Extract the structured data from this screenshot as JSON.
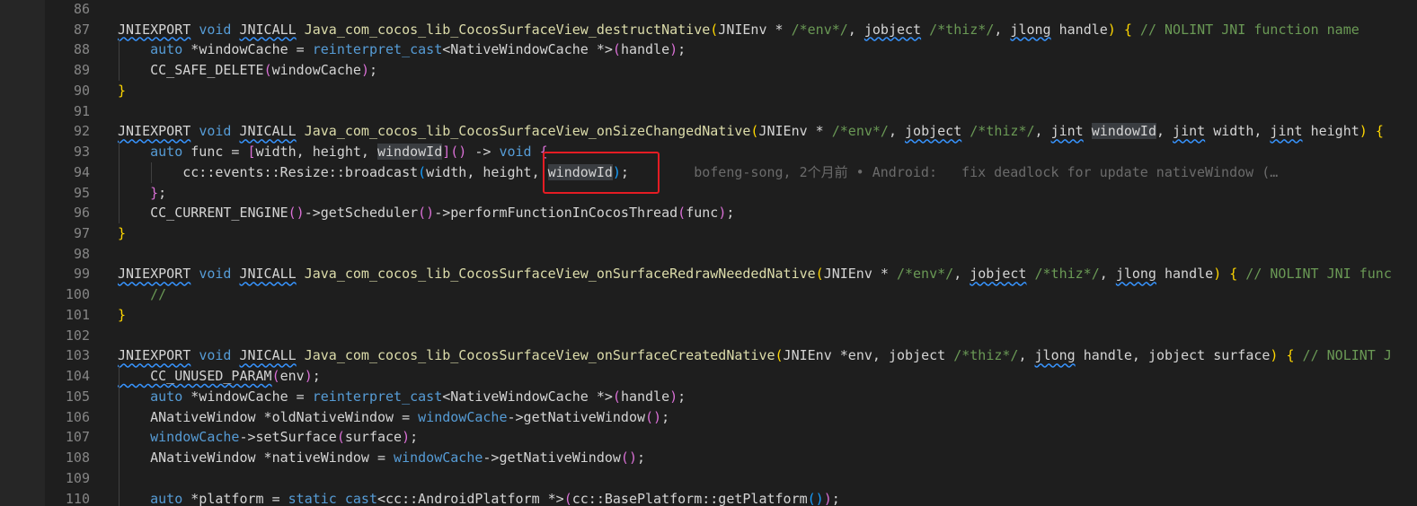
{
  "editor": {
    "lines": [
      {
        "n": "86",
        "segs": []
      },
      {
        "n": "87",
        "segs": [
          {
            "t": "JNIEXPORT",
            "c": "pl sq"
          },
          {
            "t": " ",
            "c": "pl"
          },
          {
            "t": "void",
            "c": "kw"
          },
          {
            "t": " ",
            "c": "pl"
          },
          {
            "t": "JNICALL",
            "c": "pl sq"
          },
          {
            "t": " Java_com_cocos_lib_CocosSurfaceView_destructNative",
            "c": "fn"
          },
          {
            "t": "(",
            "c": "br1"
          },
          {
            "t": "JNIEnv * ",
            "c": "pl"
          },
          {
            "t": "/*env*/",
            "c": "cm"
          },
          {
            "t": ", ",
            "c": "pl"
          },
          {
            "t": "jobject",
            "c": "pl sq"
          },
          {
            "t": " ",
            "c": "pl"
          },
          {
            "t": "/*thiz*/",
            "c": "cm"
          },
          {
            "t": ", ",
            "c": "pl"
          },
          {
            "t": "jlong",
            "c": "pl sq"
          },
          {
            "t": " handle",
            "c": "pl"
          },
          {
            "t": ")",
            "c": "br1"
          },
          {
            "t": " ",
            "c": "pl"
          },
          {
            "t": "{",
            "c": "br1"
          },
          {
            "t": " // NOLINT JNI function name",
            "c": "cm"
          }
        ]
      },
      {
        "n": "88",
        "segs": [
          {
            "t": "    ",
            "c": "pl"
          },
          {
            "t": "auto",
            "c": "kw"
          },
          {
            "t": " *",
            "c": "pl"
          },
          {
            "t": "windowCache",
            "c": "pl"
          },
          {
            "t": " = ",
            "c": "pl"
          },
          {
            "t": "reinterpret_cast",
            "c": "kw"
          },
          {
            "t": "<",
            "c": "pl"
          },
          {
            "t": "NativeWindowCache *",
            "c": "pl"
          },
          {
            "t": ">",
            "c": "pl"
          },
          {
            "t": "(",
            "c": "br2"
          },
          {
            "t": "handle",
            "c": "pl"
          },
          {
            "t": ")",
            "c": "br2"
          },
          {
            "t": ";",
            "c": "pl"
          }
        ]
      },
      {
        "n": "89",
        "segs": [
          {
            "t": "    CC_SAFE_DELETE",
            "c": "pl"
          },
          {
            "t": "(",
            "c": "br2"
          },
          {
            "t": "windowCache",
            "c": "pl"
          },
          {
            "t": ")",
            "c": "br2"
          },
          {
            "t": ";",
            "c": "pl"
          }
        ]
      },
      {
        "n": "90",
        "segs": [
          {
            "t": "}",
            "c": "br1"
          }
        ]
      },
      {
        "n": "91",
        "segs": []
      },
      {
        "n": "92",
        "segs": [
          {
            "t": "JNIEXPORT",
            "c": "pl sq"
          },
          {
            "t": " ",
            "c": "pl"
          },
          {
            "t": "void",
            "c": "kw"
          },
          {
            "t": " ",
            "c": "pl"
          },
          {
            "t": "JNICALL",
            "c": "pl sq"
          },
          {
            "t": " Java_com_cocos_lib_CocosSurfaceView_onSizeChangedNative",
            "c": "fn"
          },
          {
            "t": "(",
            "c": "br1"
          },
          {
            "t": "JNIEnv * ",
            "c": "pl"
          },
          {
            "t": "/*env*/",
            "c": "cm"
          },
          {
            "t": ", ",
            "c": "pl"
          },
          {
            "t": "jobject",
            "c": "pl sq"
          },
          {
            "t": " ",
            "c": "pl"
          },
          {
            "t": "/*thiz*/",
            "c": "cm"
          },
          {
            "t": ", ",
            "c": "pl"
          },
          {
            "t": "jint",
            "c": "pl sq"
          },
          {
            "t": " ",
            "c": "pl"
          },
          {
            "t": "windowId",
            "c": "pl sel"
          },
          {
            "t": ", ",
            "c": "pl"
          },
          {
            "t": "jint",
            "c": "pl sq"
          },
          {
            "t": " width, ",
            "c": "pl"
          },
          {
            "t": "jint",
            "c": "pl sq"
          },
          {
            "t": " height",
            "c": "pl"
          },
          {
            "t": ")",
            "c": "br1"
          },
          {
            "t": " ",
            "c": "pl"
          },
          {
            "t": "{",
            "c": "br1"
          }
        ]
      },
      {
        "n": "93",
        "segs": [
          {
            "t": "    ",
            "c": "pl"
          },
          {
            "t": "auto",
            "c": "kw"
          },
          {
            "t": " func = ",
            "c": "pl"
          },
          {
            "t": "[",
            "c": "br2"
          },
          {
            "t": "width, height, ",
            "c": "pl"
          },
          {
            "t": "windowId",
            "c": "pl sel"
          },
          {
            "t": "]",
            "c": "br2"
          },
          {
            "t": "()",
            "c": "br2"
          },
          {
            "t": " -> ",
            "c": "pl"
          },
          {
            "t": "void",
            "c": "kw"
          },
          {
            "t": " ",
            "c": "pl"
          },
          {
            "t": "{",
            "c": "br2"
          }
        ]
      },
      {
        "n": "94",
        "segs": [
          {
            "t": "        cc::events::Resize::broadcast",
            "c": "pl"
          },
          {
            "t": "(",
            "c": "br3"
          },
          {
            "t": "width, height, ",
            "c": "pl"
          },
          {
            "t": "windowId",
            "c": "pl sel"
          },
          {
            "t": ")",
            "c": "br3"
          },
          {
            "t": ";",
            "c": "pl"
          },
          {
            "t": "        bofeng-song, 2个月前 • Android:   fix deadlock for update nativeWindow (…",
            "c": "blame"
          }
        ]
      },
      {
        "n": "95",
        "segs": [
          {
            "t": "    ",
            "c": "pl"
          },
          {
            "t": "}",
            "c": "br2"
          },
          {
            "t": ";",
            "c": "pl"
          }
        ]
      },
      {
        "n": "96",
        "segs": [
          {
            "t": "    CC_CURRENT_ENGINE",
            "c": "pl"
          },
          {
            "t": "()",
            "c": "br2"
          },
          {
            "t": "->getScheduler",
            "c": "pl"
          },
          {
            "t": "()",
            "c": "br2"
          },
          {
            "t": "->performFunctionInCocosThread",
            "c": "pl"
          },
          {
            "t": "(",
            "c": "br2"
          },
          {
            "t": "func",
            "c": "pl"
          },
          {
            "t": ")",
            "c": "br2"
          },
          {
            "t": ";",
            "c": "pl"
          }
        ]
      },
      {
        "n": "97",
        "segs": [
          {
            "t": "}",
            "c": "br1"
          }
        ]
      },
      {
        "n": "98",
        "segs": []
      },
      {
        "n": "99",
        "segs": [
          {
            "t": "JNIEXPORT",
            "c": "pl sq"
          },
          {
            "t": " ",
            "c": "pl"
          },
          {
            "t": "void",
            "c": "kw"
          },
          {
            "t": " ",
            "c": "pl"
          },
          {
            "t": "JNICALL",
            "c": "pl sq"
          },
          {
            "t": " Java_com_cocos_lib_CocosSurfaceView_onSurfaceRedrawNeededNative",
            "c": "fn"
          },
          {
            "t": "(",
            "c": "br1"
          },
          {
            "t": "JNIEnv * ",
            "c": "pl"
          },
          {
            "t": "/*env*/",
            "c": "cm"
          },
          {
            "t": ", ",
            "c": "pl"
          },
          {
            "t": "jobject",
            "c": "pl sq"
          },
          {
            "t": " ",
            "c": "pl"
          },
          {
            "t": "/*thiz*/",
            "c": "cm"
          },
          {
            "t": ", ",
            "c": "pl"
          },
          {
            "t": "jlong",
            "c": "pl sq"
          },
          {
            "t": " handle",
            "c": "pl"
          },
          {
            "t": ")",
            "c": "br1"
          },
          {
            "t": " ",
            "c": "pl"
          },
          {
            "t": "{",
            "c": "br1"
          },
          {
            "t": " // NOLINT JNI func",
            "c": "cm"
          }
        ]
      },
      {
        "n": "100",
        "segs": [
          {
            "t": "    //",
            "c": "cm"
          }
        ]
      },
      {
        "n": "101",
        "segs": [
          {
            "t": "}",
            "c": "br1"
          }
        ]
      },
      {
        "n": "102",
        "segs": []
      },
      {
        "n": "103",
        "segs": [
          {
            "t": "JNIEXPORT",
            "c": "pl sq"
          },
          {
            "t": " ",
            "c": "pl"
          },
          {
            "t": "void",
            "c": "kw"
          },
          {
            "t": " ",
            "c": "pl"
          },
          {
            "t": "JNICALL",
            "c": "pl sq"
          },
          {
            "t": " Java_com_cocos_lib_CocosSurfaceView_onSurfaceCreatedNative",
            "c": "fn"
          },
          {
            "t": "(",
            "c": "br1"
          },
          {
            "t": "JNIEnv *env, jobject ",
            "c": "pl"
          },
          {
            "t": "/*thiz*/",
            "c": "cm"
          },
          {
            "t": ", ",
            "c": "pl"
          },
          {
            "t": "jlong",
            "c": "pl sq"
          },
          {
            "t": " handle, jobject surface",
            "c": "pl"
          },
          {
            "t": ")",
            "c": "br1"
          },
          {
            "t": " ",
            "c": "pl"
          },
          {
            "t": "{",
            "c": "br1"
          },
          {
            "t": " // NOLINT J",
            "c": "cm"
          }
        ]
      },
      {
        "n": "104",
        "segs": [
          {
            "t": "    CC_UNUSED_PARAM",
            "c": "pl sq"
          },
          {
            "t": "(",
            "c": "br2"
          },
          {
            "t": "env",
            "c": "pl"
          },
          {
            "t": ")",
            "c": "br2"
          },
          {
            "t": ";",
            "c": "pl"
          }
        ]
      },
      {
        "n": "105",
        "segs": [
          {
            "t": "    ",
            "c": "pl"
          },
          {
            "t": "auto",
            "c": "kw"
          },
          {
            "t": " *windowCache = ",
            "c": "pl"
          },
          {
            "t": "reinterpret_cast",
            "c": "kw"
          },
          {
            "t": "<NativeWindowCache *>",
            "c": "pl"
          },
          {
            "t": "(",
            "c": "br2"
          },
          {
            "t": "handle",
            "c": "pl"
          },
          {
            "t": ")",
            "c": "br2"
          },
          {
            "t": ";",
            "c": "pl"
          }
        ]
      },
      {
        "n": "106",
        "segs": [
          {
            "t": "    ANativeWindow *oldNativeWindow = ",
            "c": "pl"
          },
          {
            "t": "windowCache",
            "c": "kw"
          },
          {
            "t": "->getNativeWindow",
            "c": "pl"
          },
          {
            "t": "()",
            "c": "br2"
          },
          {
            "t": ";",
            "c": "pl"
          }
        ]
      },
      {
        "n": "107",
        "segs": [
          {
            "t": "    ",
            "c": "pl"
          },
          {
            "t": "windowCache",
            "c": "kw"
          },
          {
            "t": "->setSurface",
            "c": "pl"
          },
          {
            "t": "(",
            "c": "br2"
          },
          {
            "t": "surface",
            "c": "pl"
          },
          {
            "t": ")",
            "c": "br2"
          },
          {
            "t": ";",
            "c": "pl"
          }
        ]
      },
      {
        "n": "108",
        "segs": [
          {
            "t": "    ANativeWindow *nativeWindow = ",
            "c": "pl"
          },
          {
            "t": "windowCache",
            "c": "kw"
          },
          {
            "t": "->getNativeWindow",
            "c": "pl"
          },
          {
            "t": "()",
            "c": "br2"
          },
          {
            "t": ";",
            "c": "pl"
          }
        ]
      },
      {
        "n": "109",
        "segs": []
      },
      {
        "n": "110",
        "segs": [
          {
            "t": "    ",
            "c": "pl"
          },
          {
            "t": "auto",
            "c": "kw"
          },
          {
            "t": " *platform = ",
            "c": "pl"
          },
          {
            "t": "static_cast",
            "c": "kw"
          },
          {
            "t": "<cc::AndroidPlatform *>",
            "c": "pl"
          },
          {
            "t": "(",
            "c": "br2"
          },
          {
            "t": "cc::BasePlatform::getPlatform",
            "c": "pl"
          },
          {
            "t": "()",
            "c": "br3"
          },
          {
            "t": ")",
            "c": "br2"
          },
          {
            "t": ";",
            "c": "pl"
          }
        ]
      }
    ]
  },
  "colors": {
    "background": "#1e1e1e",
    "line_number": "#858585",
    "keyword": "#569cd6",
    "function": "#dcdcaa",
    "comment": "#6a9955",
    "highlight_box": "#e51c23"
  }
}
